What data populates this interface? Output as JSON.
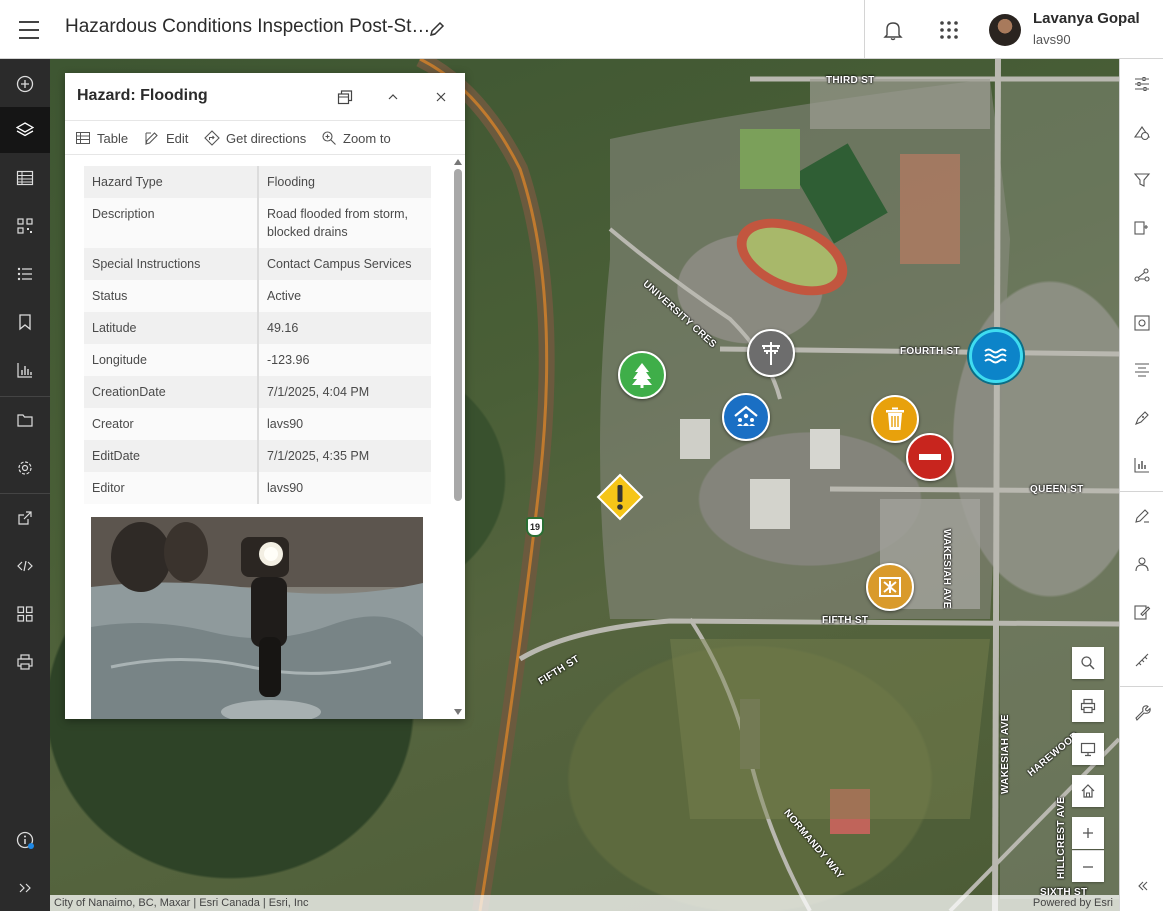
{
  "header": {
    "title": "Hazardous Conditions Inspection Post-St…",
    "user_name": "Lavanya Gopal",
    "user_id": "lavs90"
  },
  "left_toolbar": {
    "items": [
      "add-icon",
      "layers-icon",
      "table-icon",
      "qr-grid-icon",
      "legend-list-icon",
      "bookmark-icon",
      "chart-icon",
      "folder-icon",
      "settings-icon",
      "share-icon",
      "embed-code-icon",
      "widgets-icon",
      "print-icon",
      "info-icon",
      "expand-icon"
    ]
  },
  "popup": {
    "title": "Hazard: Flooding",
    "actions": [
      {
        "label": "Table",
        "icon": "table-icon"
      },
      {
        "label": "Edit",
        "icon": "edit-icon"
      },
      {
        "label": "Get directions",
        "icon": "directions-icon"
      },
      {
        "label": "Zoom to",
        "icon": "zoom-to-icon"
      }
    ],
    "fields": [
      {
        "key": "Hazard Type",
        "value": "Flooding"
      },
      {
        "key": "Description",
        "value": "Road flooded from storm, blocked drains"
      },
      {
        "key": "Special Instructions",
        "value": "Contact Campus Services"
      },
      {
        "key": "Status",
        "value": "Active"
      },
      {
        "key": "Latitude",
        "value": "49.16"
      },
      {
        "key": "Longitude",
        "value": "-123.96"
      },
      {
        "key": "CreationDate",
        "value": "7/1/2025, 4:04 PM"
      },
      {
        "key": "Creator",
        "value": "lavs90"
      },
      {
        "key": "EditDate",
        "value": "7/1/2025, 4:35 PM"
      },
      {
        "key": "Editor",
        "value": "lavs90"
      }
    ]
  },
  "map": {
    "streets": {
      "third": "THIRD ST",
      "fourth": "FOURTH ST",
      "queen": "QUEEN ST",
      "fifth": "FIFTH ST",
      "fifth_w": "FIFTH ST",
      "university": "UNIVERSITY CRES",
      "wakesiah": "WAKESIAH AVE",
      "wakesiah_s": "WAKESIAH AVE",
      "harewood": "HAREWOOD",
      "hillcrest": "HILLCREST AVE",
      "normandy": "NORMANDY WAY",
      "sixth": "SIXTH ST",
      "hwy": "19"
    },
    "markers": [
      {
        "name": "tree-hazard",
        "color": "#3fae49",
        "icon": "tree-icon"
      },
      {
        "name": "power-line-hazard",
        "color": "#6d6d6d",
        "icon": "power-pole-icon"
      },
      {
        "name": "building-hazard",
        "color": "#1a6fc4",
        "icon": "building-icon"
      },
      {
        "name": "trash-hazard",
        "color": "#e8a10c",
        "icon": "trash-icon"
      },
      {
        "name": "road-closed-hazard",
        "color": "#c8251e",
        "icon": "no-entry-icon"
      },
      {
        "name": "flooding-hazard",
        "color": "#0c84c9",
        "icon": "water-icon"
      },
      {
        "name": "general-warning-hazard",
        "color": "#f5c518",
        "icon": "exclamation-icon"
      },
      {
        "name": "debris-hazard",
        "color": "#d99a2b",
        "icon": "debris-icon"
      }
    ],
    "attribution": "City of Nanaimo, BC, Maxar | Esri Canada | Esri, Inc",
    "powered_by": "Powered by Esri"
  },
  "right_toolbar": {
    "items": [
      "properties-icon",
      "map-tools-icon",
      "filter-icon",
      "edit-layer-icon",
      "analysis-icon",
      "settings-cog-icon",
      "align-icon",
      "sketch-icon",
      "chart-data-icon",
      "pen-icon",
      "people-icon",
      "edit-note-icon",
      "measure-icon",
      "wrench-icon",
      "collapse-icon"
    ]
  }
}
